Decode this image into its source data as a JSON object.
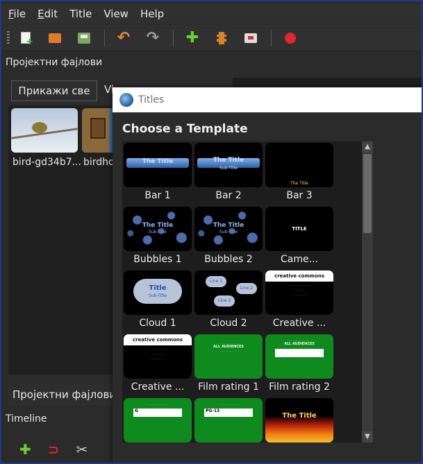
{
  "menu": {
    "items": [
      {
        "label": "File",
        "underline": "F"
      },
      {
        "label": "Edit",
        "underline": "E"
      },
      {
        "label": "Title"
      },
      {
        "label": "View"
      },
      {
        "label": "Help"
      }
    ]
  },
  "toolbar": {
    "icons": [
      "new-project-icon",
      "open-project-icon",
      "save-project-icon",
      "undo-icon",
      "redo-icon",
      "import-files-icon",
      "profile-icon",
      "export-icon",
      "record-icon"
    ]
  },
  "project_files": {
    "title": "Пројектни фајлови",
    "show_all_tab": "Прикажи све",
    "second_tab_partial": "Vi",
    "files": [
      {
        "name": "bird-gd34b7..."
      },
      {
        "name": "birdho"
      }
    ],
    "bottom_tab": "Пројектни фајлови"
  },
  "timeline": {
    "label": "Timeline"
  },
  "dialog": {
    "title": "Titles",
    "heading": "Choose a Template",
    "templates": [
      {
        "label": "Bar 1",
        "title": "The Title"
      },
      {
        "label": "Bar 2",
        "title": "The Title",
        "subtitle": "Sub-Title"
      },
      {
        "label": "Bar 3",
        "title": "The Title"
      },
      {
        "label": "Bubbles 1",
        "title": "The Title",
        "subtitle": "Sub-Title"
      },
      {
        "label": "Bubbles 2",
        "title": "The Title",
        "subtitle": "Sub-Title"
      },
      {
        "label": "Came...",
        "title": "TITLE"
      },
      {
        "label": "Cloud 1",
        "title": "Title",
        "subtitle": "Sub-Title"
      },
      {
        "label": "Cloud 2",
        "line1": "Line 1",
        "line2": "Line 2",
        "line3": "Line 3"
      },
      {
        "label": "Creative ...",
        "brand": "creative commons"
      },
      {
        "label": "Creative ...",
        "brand": "creative commons"
      },
      {
        "label": "Film rating 1",
        "text": "ALL AUDIENCES"
      },
      {
        "label": "Film rating 2",
        "text": "ALL AUDIENCES"
      },
      {
        "label": "",
        "badge": "G"
      },
      {
        "label": "",
        "badge": "PG-13"
      },
      {
        "label": "",
        "title": "The Title"
      }
    ]
  },
  "colors": {
    "window_border": "#1b3c86",
    "bg": "#2b2b2b",
    "accent_green": "#0f8a1e",
    "record_red": "#e3262b"
  }
}
